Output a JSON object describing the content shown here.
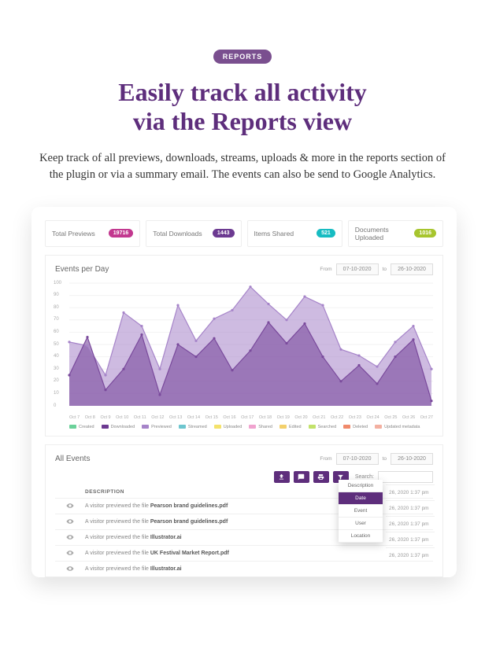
{
  "badge": "REPORTS",
  "headline_l1": "Easily track all activity",
  "headline_l2": "via the Reports view",
  "subhead": "Keep track of all previews, downloads, streams, uploads & more in the reports section of the plugin or via a summary email. The events can also be send to Google Analytics.",
  "stats": [
    {
      "label": "Total Previews",
      "value": "19716",
      "color": "#c2388f"
    },
    {
      "label": "Total Downloads",
      "value": "1443",
      "color": "#6c3a91"
    },
    {
      "label": "Items Shared",
      "value": "521",
      "color": "#17bcc2"
    },
    {
      "label": "Documents Uploaded",
      "value": "1016",
      "color": "#a7c52e"
    }
  ],
  "chart_panel": {
    "title": "Events per Day",
    "from_label": "From",
    "to_label": "to",
    "from": "07-10-2020",
    "to": "26-10-2020"
  },
  "events_panel": {
    "title": "All Events",
    "from_label": "From",
    "to_label": "to",
    "from": "07-10-2020",
    "to": "26-10-2020",
    "search_label": "Search:",
    "desc_header": "DESCRIPTION",
    "rows": [
      {
        "prefix": "A visitor previewed the file ",
        "file": "Pearson brand guidelines.pdf"
      },
      {
        "prefix": "A visitor previewed the file ",
        "file": "Pearson brand guidelines.pdf"
      },
      {
        "prefix": "A visitor previewed the file ",
        "file": "Illustrator.ai"
      },
      {
        "prefix": "A visitor previewed the file ",
        "file": "UK Festival Market Report.pdf"
      },
      {
        "prefix": "A visitor previewed the file ",
        "file": "Illustrator.ai"
      }
    ],
    "dropdown": [
      "Description",
      "Date",
      "Event",
      "User",
      "Location"
    ],
    "dropdown_selected": 1,
    "times": [
      "26, 2020 1:37 pm",
      "26, 2020 1:37 pm",
      "26, 2020 1:37 pm",
      "26, 2020 1:37 pm",
      "26, 2020 1:37 pm"
    ]
  },
  "legend": [
    {
      "label": "Created",
      "color": "#6bd19a"
    },
    {
      "label": "Downloaded",
      "color": "#6c3a91"
    },
    {
      "label": "Previewed",
      "color": "#a684c9"
    },
    {
      "label": "Streamed",
      "color": "#6ec6cf"
    },
    {
      "label": "Uploaded",
      "color": "#f4e26b"
    },
    {
      "label": "Shared",
      "color": "#f0a3cf"
    },
    {
      "label": "Edited",
      "color": "#f3d06b"
    },
    {
      "label": "Searched",
      "color": "#c2e26b"
    },
    {
      "label": "Deleted",
      "color": "#f08a6b"
    },
    {
      "label": "Updated metadata",
      "color": "#f3b0a1"
    }
  ],
  "chart_data": {
    "type": "area",
    "title": "Events per Day",
    "xlabel": "",
    "ylabel": "",
    "ylim": [
      0,
      100
    ],
    "y_ticks": [
      0,
      10,
      20,
      30,
      40,
      50,
      60,
      70,
      80,
      90,
      100
    ],
    "categories": [
      "Oct 7",
      "Oct 8",
      "Oct 9",
      "Oct 10",
      "Oct 11",
      "Oct 12",
      "Oct 13",
      "Oct 14",
      "Oct 15",
      "Oct 16",
      "Oct 17",
      "Oct 18",
      "Oct 19",
      "Oct 20",
      "Oct 21",
      "Oct 22",
      "Oct 23",
      "Oct 24",
      "Oct 25",
      "Oct 26",
      "Oct 27"
    ],
    "series": [
      {
        "name": "Previewed",
        "color": "#a684c9",
        "values": [
          52,
          49,
          25,
          76,
          65,
          30,
          82,
          53,
          71,
          78,
          97,
          83,
          70,
          89,
          82,
          46,
          41,
          32,
          52,
          65,
          30
        ]
      },
      {
        "name": "Downloaded",
        "color": "#7a4a9c",
        "values": [
          25,
          56,
          13,
          30,
          58,
          9,
          50,
          40,
          55,
          29,
          45,
          68,
          51,
          67,
          40,
          20,
          33,
          18,
          40,
          54,
          4
        ]
      }
    ]
  }
}
